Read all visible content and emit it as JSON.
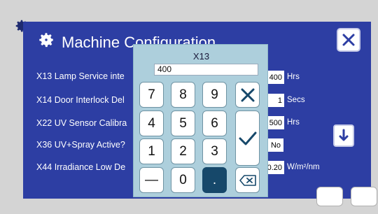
{
  "header": {
    "title": "Machine Configuration"
  },
  "rows": [
    {
      "label": "X13 Lamp Service inte",
      "value": "400",
      "unit": "Hrs"
    },
    {
      "label": "X14 Door Interlock Del",
      "value": "1",
      "unit": "Secs"
    },
    {
      "label": "X22 UV Sensor Calibra",
      "value": "500",
      "unit": "Hrs"
    },
    {
      "label": "X36 UV+Spray Active?",
      "value": "No",
      "unit": ""
    },
    {
      "label": "X44 Irradiance Low De",
      "value": "0.20",
      "unit": "W/m²/nm"
    }
  ],
  "keypad": {
    "title": "X13",
    "input_value": "400",
    "keys": {
      "k7": "7",
      "k8": "8",
      "k9": "9",
      "k4": "4",
      "k5": "5",
      "k6": "6",
      "k1": "1",
      "k2": "2",
      "k3": "3",
      "minus": "—",
      "k0": "0",
      "dot": "."
    }
  },
  "colors": {
    "background": "#d4d4d4",
    "panel": "#2d3ea3",
    "keypad": "#adcfdc",
    "key_dark": "#16486a"
  },
  "icons": {
    "settings": "gear-icon",
    "close": "close-icon",
    "scroll_down": "arrow-down-icon",
    "cancel": "x-icon",
    "confirm": "checkmark-icon",
    "backspace": "backspace-icon"
  }
}
